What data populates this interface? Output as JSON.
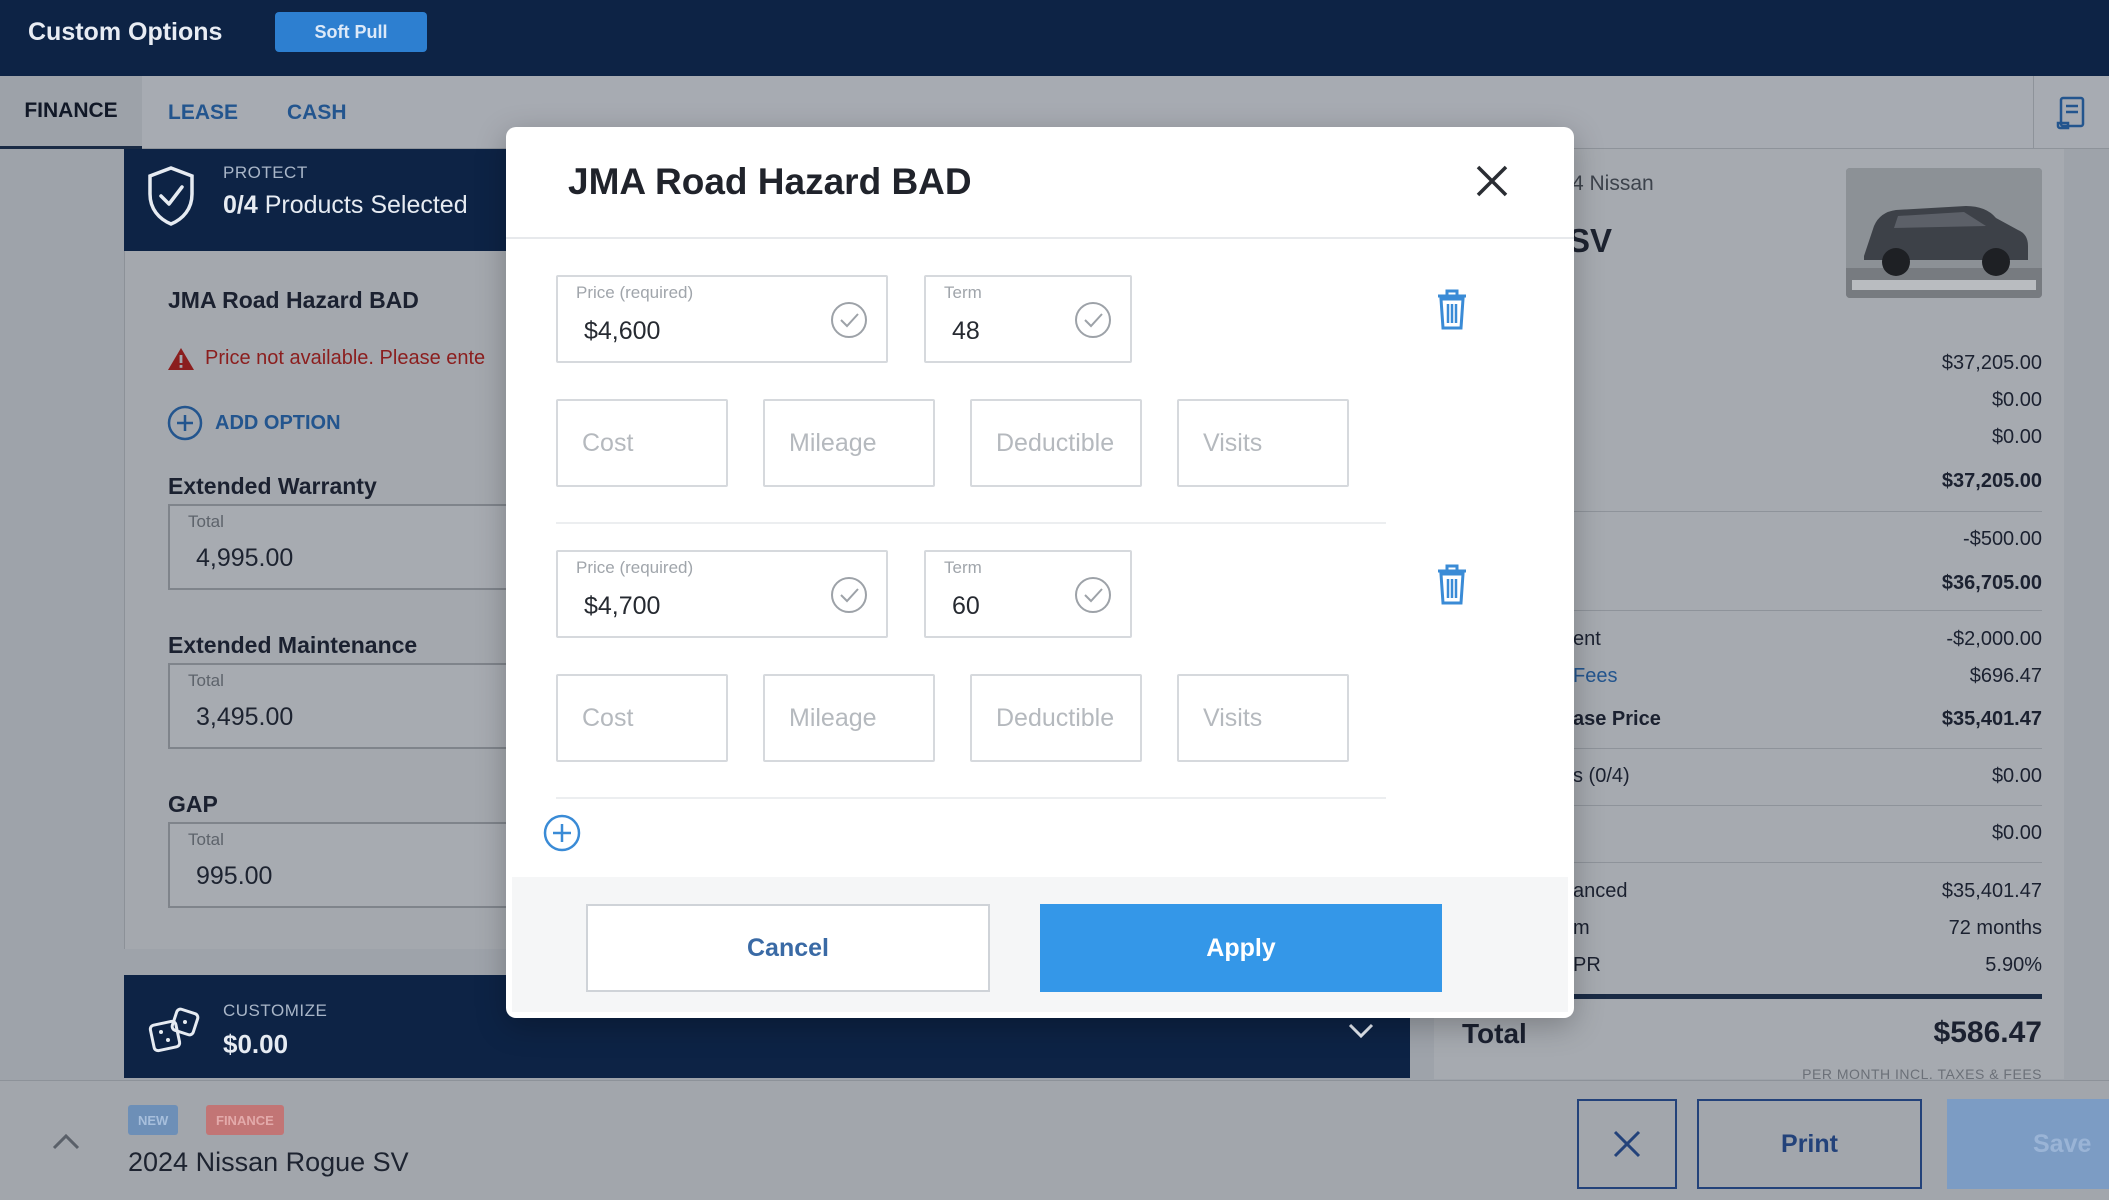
{
  "header": {
    "title": "Custom Options",
    "soft_pull_label": "Soft Pull"
  },
  "tabs": {
    "finance": "FINANCE",
    "lease": "LEASE",
    "cash": "CASH"
  },
  "protect": {
    "label": "PROTECT",
    "count": "0/4",
    "selected_text": " Products Selected"
  },
  "product": {
    "name": "JMA Road Hazard BAD",
    "warning": "Price not available. Please ente",
    "add_option": "ADD OPTION"
  },
  "sections": [
    {
      "label": "Extended Warranty",
      "total_label": "Total",
      "total": "4,995.00"
    },
    {
      "label": "Extended Maintenance",
      "total_label": "Total",
      "total": "3,495.00"
    },
    {
      "label": "GAP",
      "total_label": "Total",
      "total": "995.00"
    }
  ],
  "customize": {
    "label": "CUSTOMIZE",
    "value": "$0.00"
  },
  "summary": {
    "make": "4 Nissan",
    "model": "SV",
    "rows": [
      {
        "label": "",
        "value": "$37,205.00"
      },
      {
        "label": "",
        "value": "$0.00"
      },
      {
        "label": "",
        "value": "$0.00"
      },
      {
        "label": "",
        "value": "$37,205.00"
      },
      {
        "label": "",
        "value": "-$500.00"
      },
      {
        "label": "",
        "value": "$36,705.00"
      },
      {
        "label": "ent",
        "value": "-$2,000.00"
      },
      {
        "label": "Fees",
        "value": "$696.47"
      },
      {
        "label": "ase Price",
        "value": "$35,401.47"
      },
      {
        "label": "s (0/4)",
        "value": "$0.00"
      },
      {
        "label": "",
        "value": "$0.00"
      },
      {
        "label": "anced",
        "value": "$35,401.47"
      },
      {
        "label": "m",
        "value": "72 months"
      },
      {
        "label": "PR",
        "value": "5.90%"
      }
    ],
    "total_label": "Total",
    "total_value": "$586.47",
    "per_month": "PER MONTH INCL. TAXES & FEES"
  },
  "footer": {
    "badge_new": "NEW",
    "badge_finance": "FINANCE",
    "vehicle": "2024 Nissan Rogue SV",
    "print_label": "Print",
    "save_label": "Save"
  },
  "modal": {
    "title": "JMA Road Hazard BAD",
    "options": [
      {
        "price_label": "Price (required)",
        "price": "$4,600",
        "term_label": "Term",
        "term": "48",
        "cost_placeholder": "Cost",
        "mileage_placeholder": "Mileage",
        "deductible_placeholder": "Deductible",
        "visits_placeholder": "Visits"
      },
      {
        "price_label": "Price (required)",
        "price": "$4,700",
        "term_label": "Term",
        "term": "60",
        "cost_placeholder": "Cost",
        "mileage_placeholder": "Mileage",
        "deductible_placeholder": "Deductible",
        "visits_placeholder": "Visits"
      }
    ],
    "cancel_label": "Cancel",
    "apply_label": "Apply"
  },
  "colors": {
    "navy": "#0d2345",
    "accent": "#3497e8",
    "link": "#23558e",
    "warning": "#8b1e1e"
  }
}
